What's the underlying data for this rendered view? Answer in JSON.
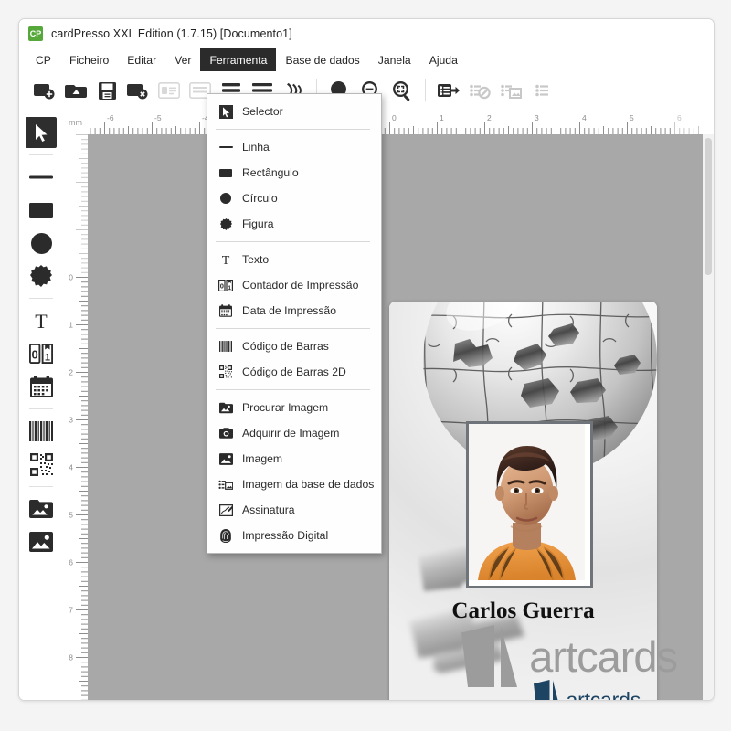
{
  "window": {
    "title": "cardPresso XXL Edition (1.7.15) [Documento1]",
    "app_icon_text": "CP",
    "app_icon_color": "#56a83b"
  },
  "menubar": {
    "items": [
      {
        "label": "CP",
        "active": false
      },
      {
        "label": "Ficheiro",
        "active": false
      },
      {
        "label": "Editar",
        "active": false
      },
      {
        "label": "Ver",
        "active": false
      },
      {
        "label": "Ferramenta",
        "active": true
      },
      {
        "label": "Base de dados",
        "active": false
      },
      {
        "label": "Janela",
        "active": false
      },
      {
        "label": "Ajuda",
        "active": false
      }
    ]
  },
  "toolbar": {
    "buttons": [
      {
        "name": "new-card-icon",
        "state": "enabled"
      },
      {
        "name": "open-card-icon",
        "state": "enabled"
      },
      {
        "name": "save-icon",
        "state": "enabled"
      },
      {
        "name": "close-card-icon",
        "state": "enabled"
      },
      {
        "name": "card-front-icon",
        "state": "enabled"
      },
      {
        "name": "card-back-icon",
        "state": "enabled"
      },
      {
        "name": "card-both-icon",
        "state": "enabled"
      },
      {
        "name": "list-view-icon",
        "state": "enabled"
      },
      {
        "name": "print-wireless-icon",
        "state": "enabled"
      },
      {
        "name": "zoom-in-icon",
        "state": "enabled"
      },
      {
        "name": "zoom-out-icon",
        "state": "enabled"
      },
      {
        "name": "zoom-fit-icon",
        "state": "enabled"
      },
      {
        "name": "database-connect-icon",
        "state": "enabled"
      },
      {
        "name": "database-disconnect-icon",
        "state": "disabled"
      },
      {
        "name": "database-image-icon",
        "state": "disabled"
      },
      {
        "name": "database-records-icon",
        "state": "disabled"
      }
    ]
  },
  "tool_palette": {
    "tools": [
      {
        "name": "selector-tool",
        "selected": true
      },
      {
        "name": "line-tool",
        "selected": false
      },
      {
        "name": "rectangle-tool",
        "selected": false
      },
      {
        "name": "circle-tool",
        "selected": false
      },
      {
        "name": "shape-tool",
        "selected": false
      },
      {
        "name": "text-tool",
        "selected": false
      },
      {
        "name": "print-counter-tool",
        "selected": false
      },
      {
        "name": "print-date-tool",
        "selected": false
      },
      {
        "name": "barcode-tool",
        "selected": false
      },
      {
        "name": "barcode-2d-tool",
        "selected": false
      },
      {
        "name": "browse-image-tool",
        "selected": false
      },
      {
        "name": "image-tool",
        "selected": false
      }
    ]
  },
  "rulers": {
    "unit": "mm",
    "horizontal_labels": [
      "-5",
      "-4",
      "0",
      "1",
      "2",
      "3",
      "5",
      "6"
    ],
    "vertical_labels": [
      "0",
      "1",
      "2",
      "3",
      "4",
      "5",
      "6",
      "7",
      "8"
    ]
  },
  "dropdown": {
    "title": "Ferramenta",
    "groups": [
      {
        "items": [
          {
            "label": "Selector",
            "icon": "cursor-arrow-icon",
            "highlighted": true
          }
        ]
      },
      {
        "items": [
          {
            "label": "Linha",
            "icon": "line-icon",
            "highlighted": false
          },
          {
            "label": "Rectângulo",
            "icon": "rectangle-icon",
            "highlighted": false
          },
          {
            "label": "Círculo",
            "icon": "circle-icon",
            "highlighted": false
          },
          {
            "label": "Figura",
            "icon": "star-shape-icon",
            "highlighted": false
          }
        ]
      },
      {
        "items": [
          {
            "label": "Texto",
            "icon": "text-icon",
            "highlighted": false
          },
          {
            "label": "Contador de Impressão",
            "icon": "print-counter-icon",
            "highlighted": false
          },
          {
            "label": "Data de Impressão",
            "icon": "calendar-icon",
            "highlighted": false
          }
        ]
      },
      {
        "items": [
          {
            "label": "Código de Barras",
            "icon": "barcode-icon",
            "highlighted": false
          },
          {
            "label": "Código de Barras 2D",
            "icon": "qrcode-icon",
            "highlighted": false
          }
        ]
      },
      {
        "items": [
          {
            "label": "Procurar Imagem",
            "icon": "browse-image-icon",
            "highlighted": false
          },
          {
            "label": "Adquirir de Imagem",
            "icon": "camera-icon",
            "highlighted": false
          },
          {
            "label": "Imagem",
            "icon": "picture-icon",
            "highlighted": false
          },
          {
            "label": "Imagem da base de dados",
            "icon": "database-image-icon",
            "highlighted": false
          },
          {
            "label": "Assinatura",
            "icon": "signature-icon",
            "highlighted": false
          },
          {
            "label": "Impressão Digital",
            "icon": "fingerprint-icon",
            "highlighted": false
          }
        ]
      }
    ]
  },
  "card": {
    "name": "Carlos Guerra",
    "logo_text": "artcards",
    "logo_color": "#1e4463",
    "background_description": "metallic puzzle globe",
    "photo_description": "portrait of man in orange striped shirt"
  },
  "watermark": {
    "text": "artcards",
    "color": "#9c9c9c"
  }
}
